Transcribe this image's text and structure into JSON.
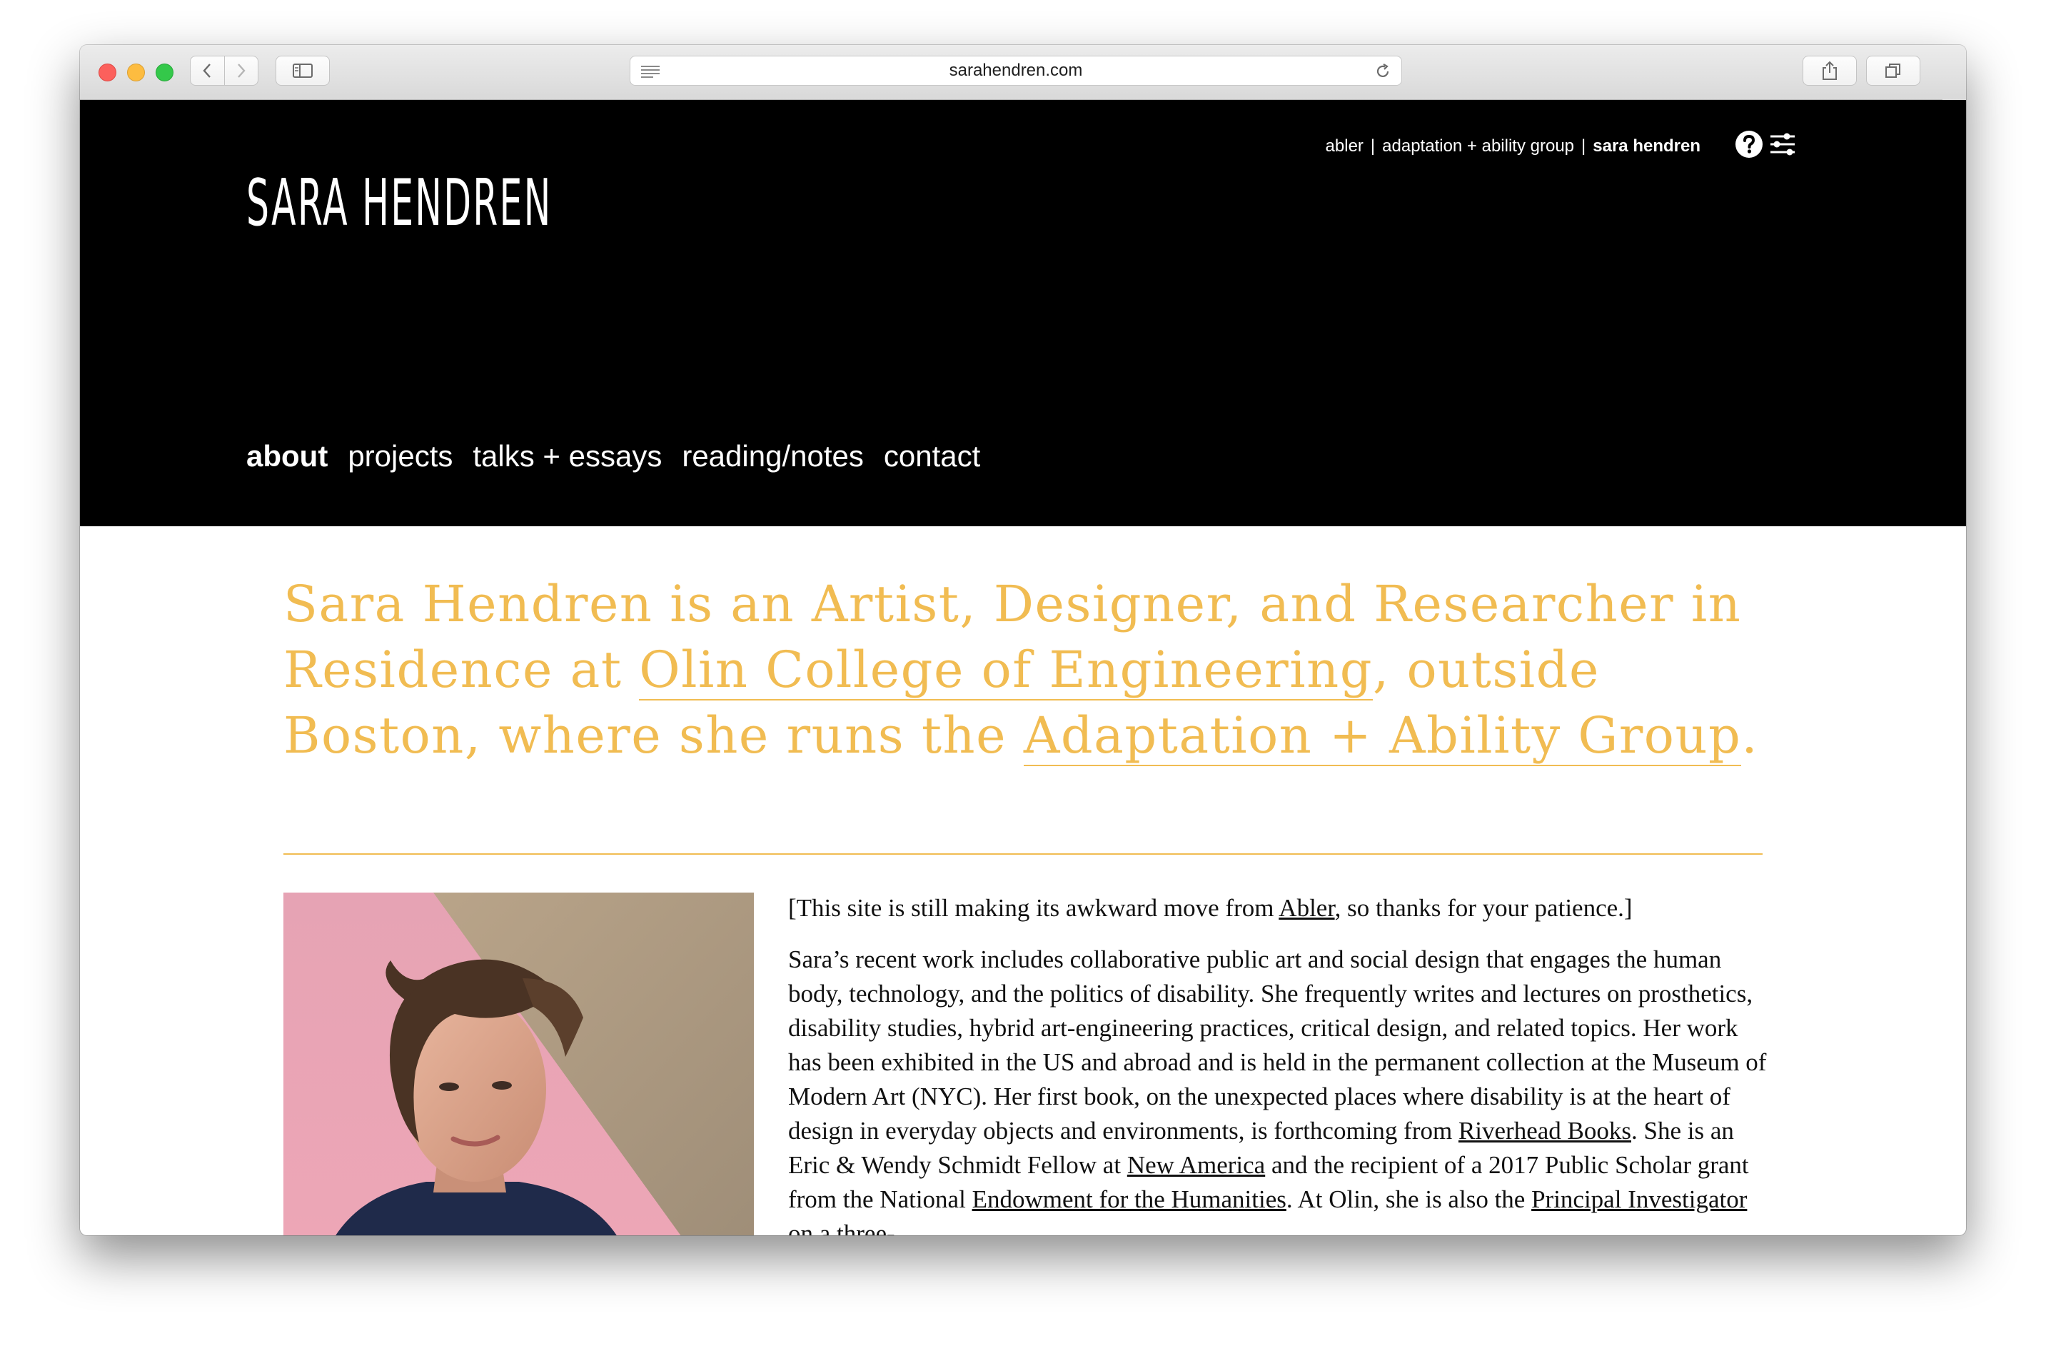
{
  "browser": {
    "url": "sarahendren.com"
  },
  "site": {
    "logo": "SARA HENDREN",
    "top_nav": [
      "abler",
      "adaptation + ability group",
      "sara hendren"
    ],
    "top_nav_separator": "|",
    "main_nav": [
      "about",
      "projects",
      "talks + essays",
      "reading/notes",
      "contact"
    ],
    "active_nav": "about"
  },
  "headline": {
    "part1": "Sara Hendren is an Artist, Designer, and Researcher in Residence at ",
    "link1": "Olin College of Engineering",
    "part2": ", outside Boston, where she runs the ",
    "link2": "Adaptation + Ability Group",
    "part3": "."
  },
  "notice": {
    "before": "[This site is still making its awkward move from ",
    "link": "Abler",
    "after": ", so thanks for your patience.]"
  },
  "bio": {
    "text1": "Sara’s recent work includes collaborative public art and social design that engages the human body, technology, and the politics of disability. She frequently writes and lectures on prosthetics, disability studies, hybrid art-engineering practices, critical design, and related topics. Her work has been exhibited in the US and abroad and is held in the permanent collection at the Museum of Modern Art (NYC). Her first book, on the unexpected places where disability is at the heart of design in everyday objects and environments, is forthcoming from ",
    "link1": "Riverhead Books",
    "text2": ". She is an Eric & Wendy Schmidt Fellow at ",
    "link2": "New America",
    "text3": " and the recipient of a 2017 Public Scholar grant from the National ",
    "link3": "Endowment for the Humanities",
    "text4": ". At Olin, she is also the ",
    "link4": "Principal Investigator",
    "text5": " on a three-"
  },
  "colors": {
    "header_bg": "#000000",
    "accent": "#f1bc52",
    "body_text": "#111111"
  },
  "icons": [
    "back-icon",
    "forward-icon",
    "sidebar-icon",
    "reader-icon",
    "reload-icon",
    "share-icon",
    "tabs-icon",
    "plus-icon",
    "help-icon",
    "settings-icon"
  ]
}
